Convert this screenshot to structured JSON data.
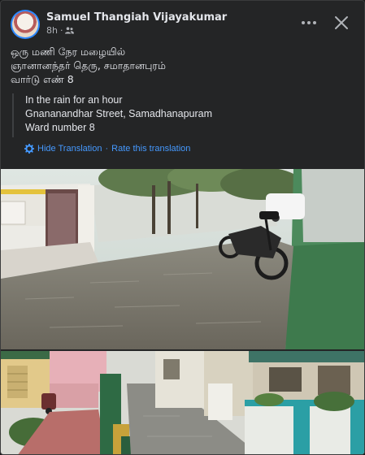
{
  "post": {
    "author": "Samuel Thangiah Vijayakumar",
    "time": "8h",
    "privacy_icon": "friends-icon",
    "original_lines": [
      "ஒரு மணி நேர மழையில்",
      "ஞானானந்தர் தெரு, சமாதானபுரம்",
      "வார்டு எண் 8"
    ],
    "translation_lines": [
      "In the rain for an hour",
      "Gnananandhar Street, Samadhanapuram",
      "Ward number 8"
    ],
    "hide_translation": "Hide Translation",
    "separator": "·",
    "rate_translation": "Rate this translation"
  },
  "colors": {
    "card_bg": "#242526",
    "text": "#e4e6eb",
    "secondary": "#b0b3b8",
    "link": "#4599ff"
  }
}
